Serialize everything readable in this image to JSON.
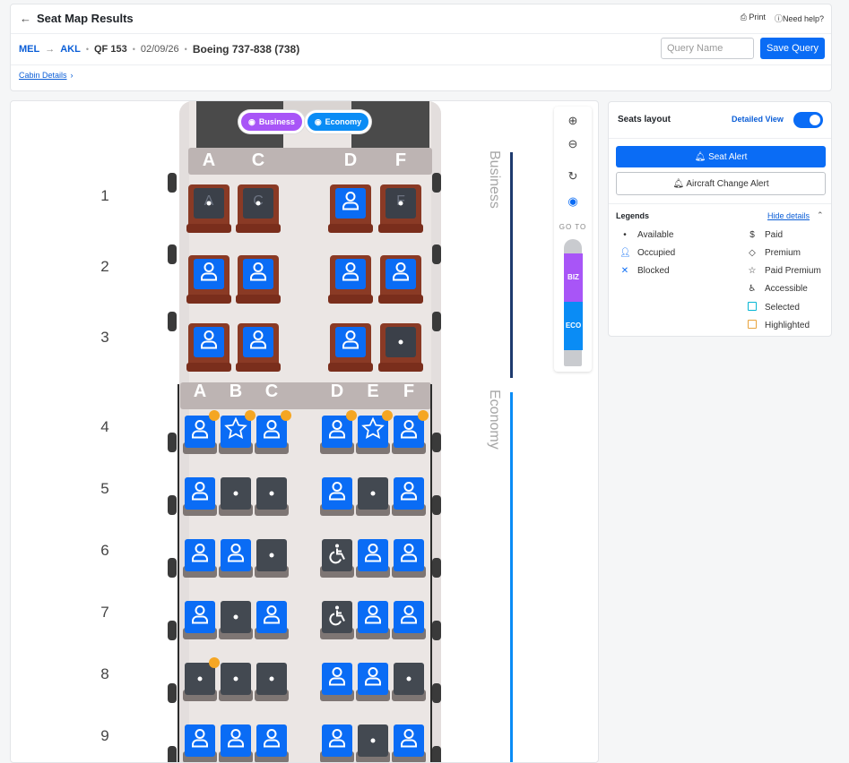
{
  "header": {
    "back_icon": "arrow-left-icon",
    "title": "Seat Map Results",
    "print": "Print",
    "help": "Need help?"
  },
  "route": {
    "origin": "MEL",
    "destination": "AKL",
    "flight": "QF 153",
    "date": "02/09/26",
    "aircraft": "Boeing 737-838 (738)"
  },
  "query": {
    "placeholder": "Query Name",
    "save": "Save Query"
  },
  "cabin_details": "Cabin Details",
  "cabins": {
    "business": "Business",
    "economy": "Economy",
    "biz_color": "#a855f7",
    "eco_color": "#0a6cf5"
  },
  "business_cols": [
    "A",
    "C",
    "D",
    "F"
  ],
  "economy_cols": [
    "A",
    "B",
    "C",
    "D",
    "E",
    "F"
  ],
  "rows": [
    "1",
    "2",
    "3",
    "4",
    "5",
    "6",
    "7",
    "8",
    "9"
  ],
  "section_labels": {
    "business": "Business",
    "economy": "Economy"
  },
  "seats_business": [
    {
      "row": "1",
      "seats": [
        {
          "col": "A",
          "state": "available",
          "label": "A"
        },
        {
          "col": "C",
          "state": "available",
          "label": "C"
        },
        {
          "col": "D",
          "state": "occupied"
        },
        {
          "col": "F",
          "state": "available",
          "label": "F"
        }
      ]
    },
    {
      "row": "2",
      "seats": [
        {
          "col": "A",
          "state": "occupied"
        },
        {
          "col": "C",
          "state": "occupied"
        },
        {
          "col": "D",
          "state": "occupied"
        },
        {
          "col": "F",
          "state": "occupied"
        }
      ]
    },
    {
      "row": "3",
      "seats": [
        {
          "col": "A",
          "state": "occupied"
        },
        {
          "col": "C",
          "state": "occupied"
        },
        {
          "col": "D",
          "state": "occupied"
        },
        {
          "col": "F",
          "state": "available"
        }
      ]
    }
  ],
  "seats_economy": [
    {
      "row": "4",
      "seats": [
        "occupied",
        "premium",
        "occupied",
        "occupied",
        "premium",
        "occupied"
      ],
      "highlight": [
        true,
        true,
        true,
        true,
        true,
        true
      ]
    },
    {
      "row": "5",
      "seats": [
        "occupied",
        "available",
        "available",
        "occupied",
        "available",
        "occupied"
      ],
      "highlight": [
        false,
        false,
        false,
        false,
        false,
        false
      ]
    },
    {
      "row": "6",
      "seats": [
        "occupied",
        "occupied",
        "available",
        "accessible",
        "occupied",
        "occupied"
      ],
      "highlight": [
        false,
        false,
        false,
        false,
        false,
        false
      ]
    },
    {
      "row": "7",
      "seats": [
        "occupied",
        "available",
        "occupied",
        "accessible",
        "occupied",
        "occupied"
      ],
      "highlight": [
        false,
        false,
        false,
        false,
        false,
        false
      ]
    },
    {
      "row": "8",
      "seats": [
        "available",
        "available",
        "available",
        "occupied",
        "occupied",
        "available"
      ],
      "highlight": [
        true,
        false,
        false,
        false,
        false,
        false
      ]
    },
    {
      "row": "9",
      "seats": [
        "occupied",
        "occupied",
        "occupied",
        "occupied",
        "available",
        "occupied"
      ],
      "highlight": [
        false,
        false,
        false,
        false,
        false,
        false
      ]
    }
  ],
  "map_controls": {
    "zoom_in": "zoom-in-icon",
    "zoom_out": "zoom-out-icon",
    "reset": "reset-icon",
    "view": "eye-icon",
    "goto": "GO TO",
    "biz": "BIZ",
    "eco": "ECO"
  },
  "panel": {
    "title": "Seats layout",
    "detailed": "Detailed View",
    "toggle_on": true,
    "seat_alert": "Seat Alert",
    "aircraft_alert": "Aircraft Change Alert",
    "legends_title": "Legends",
    "hide": "Hide details",
    "legends_left": [
      {
        "icon": "dot-icon",
        "label": "Available"
      },
      {
        "icon": "person-icon",
        "label": "Occupied"
      },
      {
        "icon": "x-icon",
        "label": "Blocked"
      }
    ],
    "legends_right": [
      {
        "icon": "dollar-icon",
        "label": "Paid"
      },
      {
        "icon": "diamond-icon",
        "label": "Premium"
      },
      {
        "icon": "star-icon",
        "label": "Paid Premium"
      },
      {
        "icon": "accessible-icon",
        "label": "Accessible"
      },
      {
        "icon": "selected-square-icon",
        "label": "Selected",
        "color": "#06b6d4"
      },
      {
        "icon": "highlighted-square-icon",
        "label": "Highlighted",
        "color": "#e8a33d"
      }
    ]
  }
}
